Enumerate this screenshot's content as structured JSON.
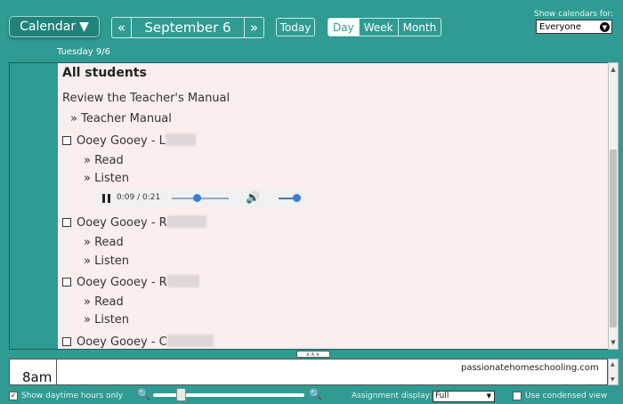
{
  "toolbar": {
    "calendar_label": "Calendar",
    "calendar_arrow": "▼",
    "prev": "«",
    "next": "»",
    "date": "September 6",
    "today": "Today",
    "views": [
      "Day",
      "Week",
      "Month"
    ],
    "active_view": "Day",
    "show_calendars_label": "Show calendars for:",
    "show_calendars_value": "Everyone"
  },
  "day_header": "Tuesday 9/6",
  "content": {
    "group_title": "All students",
    "instruction": "Review the Teacher's Manual",
    "manual_link": "» Teacher Manual",
    "items": [
      {
        "title": "Ooey Gooey - L",
        "links": [
          "» Read",
          "» Listen"
        ],
        "audio_time": "0:09 / 0:21",
        "audio_progress": 0.43,
        "volume": 1.0
      },
      {
        "title": "Ooey Gooey - R",
        "links": [
          "» Read",
          "» Listen"
        ]
      },
      {
        "title": "Ooey Gooey - R",
        "links": [
          "» Read",
          "» Listen"
        ]
      },
      {
        "title": "Ooey Gooey - C",
        "links": []
      }
    ]
  },
  "collapse_handle": "∧∧∧",
  "time_slot": "8am",
  "watermark": "passionatehomeschooling.com",
  "footer": {
    "daytime_label": "Show daytime hours only",
    "daytime_checked": true,
    "assignment_label": "Assignment display:",
    "assignment_value": "Full",
    "condensed_label": "Use condensed view",
    "condensed_checked": false,
    "zoom_level": 0.17
  },
  "colors": {
    "background": "#2f9b93",
    "content": "#fbeeee",
    "accent": "#3b7bdb"
  },
  "icons": [
    "pause-icon",
    "volume-icon",
    "zoom-out-icon",
    "zoom-in-icon",
    "dropdown-icon"
  ]
}
